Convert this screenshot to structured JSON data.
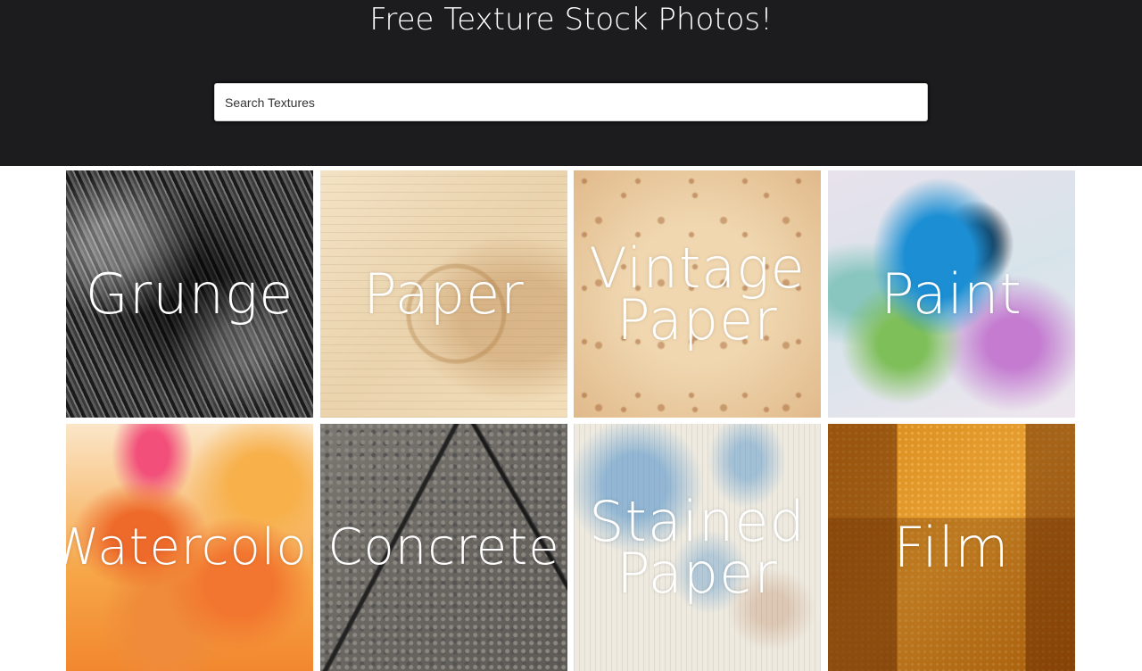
{
  "header": {
    "title": "Free Texture Stock Photos!"
  },
  "search": {
    "placeholder": "Search Textures",
    "value": ""
  },
  "categories": [
    {
      "label": "Grunge"
    },
    {
      "label": "Paper"
    },
    {
      "label": "Vintage Paper"
    },
    {
      "label": "Paint"
    },
    {
      "label": "Watercolor"
    },
    {
      "label": "Concrete"
    },
    {
      "label": "Stained Paper"
    },
    {
      "label": "Film"
    }
  ],
  "colors": {
    "header_bg": "#1c1c1e",
    "page_bg": "#ffffff",
    "label_text": "#ffffff"
  }
}
